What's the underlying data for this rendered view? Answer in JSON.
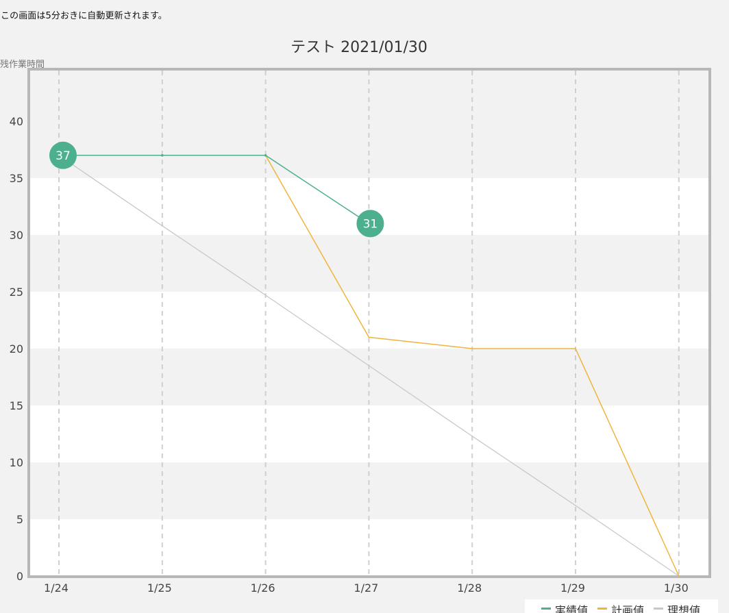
{
  "page": {
    "notice": "この画面は5分おきに自動更新されます。"
  },
  "chart_data": {
    "type": "line",
    "title": "テスト 2021/01/30",
    "ylabel": "残作業時間",
    "xlabel": "",
    "categories": [
      "1/24",
      "1/25",
      "1/26",
      "1/27",
      "1/28",
      "1/29",
      "1/30"
    ],
    "ylim": [
      0,
      40
    ],
    "yticks": [
      0,
      5,
      10,
      15,
      20,
      25,
      30,
      35,
      40
    ],
    "grid": true,
    "legend_position": "bottom-right",
    "series": [
      {
        "name": "実績値",
        "values": [
          37,
          37,
          37,
          31,
          null,
          null,
          null
        ],
        "color": "#4caf8d",
        "labels": [
          37,
          null,
          null,
          31,
          null,
          null,
          null
        ]
      },
      {
        "name": "計画値",
        "values": [
          null,
          null,
          37,
          21,
          20,
          20,
          0
        ],
        "color": "#f0b43c"
      },
      {
        "name": "理想値",
        "values": [
          37,
          30.8,
          24.7,
          18.5,
          12.3,
          6.2,
          0
        ],
        "color": "#c8c8c8"
      }
    ]
  }
}
